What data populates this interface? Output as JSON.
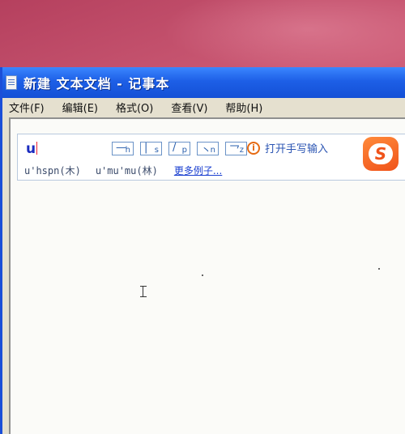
{
  "window": {
    "title": "新建 文本文档 - 记事本"
  },
  "menu": [
    "文件(F)",
    "编辑(E)",
    "格式(O)",
    "查看(V)",
    "帮助(H)"
  ],
  "ime": {
    "input": "u",
    "tones": [
      {
        "mark": "—",
        "letter": "h"
      },
      {
        "mark": "|",
        "letter": "s"
      },
      {
        "mark": "/",
        "letter": "p"
      },
      {
        "mark": "丶",
        "letter": "n"
      },
      {
        "mark": "乛",
        "letter": "z"
      }
    ],
    "handwriting_label": "打开手写输入",
    "handwriting_icon": "i",
    "logo_letter": "S",
    "examples": [
      "u'hspn(木)",
      "u'mu'mu(林)"
    ],
    "more_examples": "更多例子..."
  },
  "colors": {
    "titlebar": "#1d5fe6",
    "logo": "#f0531a",
    "link": "#1a3fd0"
  }
}
